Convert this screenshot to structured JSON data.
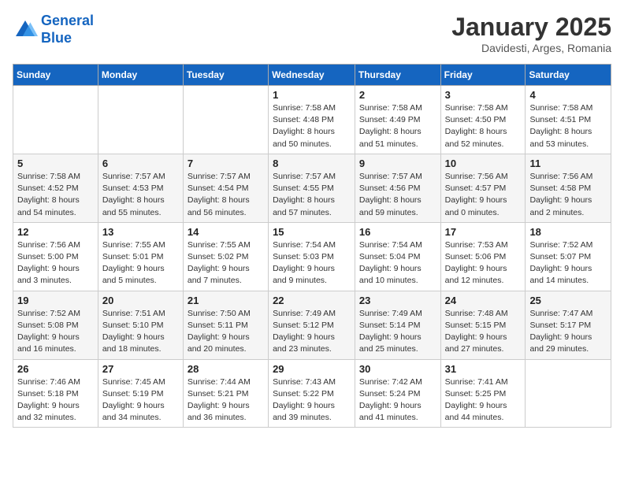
{
  "logo": {
    "line1": "General",
    "line2": "Blue"
  },
  "title": "January 2025",
  "subtitle": "Davidesti, Arges, Romania",
  "weekdays": [
    "Sunday",
    "Monday",
    "Tuesday",
    "Wednesday",
    "Thursday",
    "Friday",
    "Saturday"
  ],
  "weeks": [
    [
      {
        "day": "",
        "info": ""
      },
      {
        "day": "",
        "info": ""
      },
      {
        "day": "",
        "info": ""
      },
      {
        "day": "1",
        "info": "Sunrise: 7:58 AM\nSunset: 4:48 PM\nDaylight: 8 hours\nand 50 minutes."
      },
      {
        "day": "2",
        "info": "Sunrise: 7:58 AM\nSunset: 4:49 PM\nDaylight: 8 hours\nand 51 minutes."
      },
      {
        "day": "3",
        "info": "Sunrise: 7:58 AM\nSunset: 4:50 PM\nDaylight: 8 hours\nand 52 minutes."
      },
      {
        "day": "4",
        "info": "Sunrise: 7:58 AM\nSunset: 4:51 PM\nDaylight: 8 hours\nand 53 minutes."
      }
    ],
    [
      {
        "day": "5",
        "info": "Sunrise: 7:58 AM\nSunset: 4:52 PM\nDaylight: 8 hours\nand 54 minutes."
      },
      {
        "day": "6",
        "info": "Sunrise: 7:57 AM\nSunset: 4:53 PM\nDaylight: 8 hours\nand 55 minutes."
      },
      {
        "day": "7",
        "info": "Sunrise: 7:57 AM\nSunset: 4:54 PM\nDaylight: 8 hours\nand 56 minutes."
      },
      {
        "day": "8",
        "info": "Sunrise: 7:57 AM\nSunset: 4:55 PM\nDaylight: 8 hours\nand 57 minutes."
      },
      {
        "day": "9",
        "info": "Sunrise: 7:57 AM\nSunset: 4:56 PM\nDaylight: 8 hours\nand 59 minutes."
      },
      {
        "day": "10",
        "info": "Sunrise: 7:56 AM\nSunset: 4:57 PM\nDaylight: 9 hours\nand 0 minutes."
      },
      {
        "day": "11",
        "info": "Sunrise: 7:56 AM\nSunset: 4:58 PM\nDaylight: 9 hours\nand 2 minutes."
      }
    ],
    [
      {
        "day": "12",
        "info": "Sunrise: 7:56 AM\nSunset: 5:00 PM\nDaylight: 9 hours\nand 3 minutes."
      },
      {
        "day": "13",
        "info": "Sunrise: 7:55 AM\nSunset: 5:01 PM\nDaylight: 9 hours\nand 5 minutes."
      },
      {
        "day": "14",
        "info": "Sunrise: 7:55 AM\nSunset: 5:02 PM\nDaylight: 9 hours\nand 7 minutes."
      },
      {
        "day": "15",
        "info": "Sunrise: 7:54 AM\nSunset: 5:03 PM\nDaylight: 9 hours\nand 9 minutes."
      },
      {
        "day": "16",
        "info": "Sunrise: 7:54 AM\nSunset: 5:04 PM\nDaylight: 9 hours\nand 10 minutes."
      },
      {
        "day": "17",
        "info": "Sunrise: 7:53 AM\nSunset: 5:06 PM\nDaylight: 9 hours\nand 12 minutes."
      },
      {
        "day": "18",
        "info": "Sunrise: 7:52 AM\nSunset: 5:07 PM\nDaylight: 9 hours\nand 14 minutes."
      }
    ],
    [
      {
        "day": "19",
        "info": "Sunrise: 7:52 AM\nSunset: 5:08 PM\nDaylight: 9 hours\nand 16 minutes."
      },
      {
        "day": "20",
        "info": "Sunrise: 7:51 AM\nSunset: 5:10 PM\nDaylight: 9 hours\nand 18 minutes."
      },
      {
        "day": "21",
        "info": "Sunrise: 7:50 AM\nSunset: 5:11 PM\nDaylight: 9 hours\nand 20 minutes."
      },
      {
        "day": "22",
        "info": "Sunrise: 7:49 AM\nSunset: 5:12 PM\nDaylight: 9 hours\nand 23 minutes."
      },
      {
        "day": "23",
        "info": "Sunrise: 7:49 AM\nSunset: 5:14 PM\nDaylight: 9 hours\nand 25 minutes."
      },
      {
        "day": "24",
        "info": "Sunrise: 7:48 AM\nSunset: 5:15 PM\nDaylight: 9 hours\nand 27 minutes."
      },
      {
        "day": "25",
        "info": "Sunrise: 7:47 AM\nSunset: 5:17 PM\nDaylight: 9 hours\nand 29 minutes."
      }
    ],
    [
      {
        "day": "26",
        "info": "Sunrise: 7:46 AM\nSunset: 5:18 PM\nDaylight: 9 hours\nand 32 minutes."
      },
      {
        "day": "27",
        "info": "Sunrise: 7:45 AM\nSunset: 5:19 PM\nDaylight: 9 hours\nand 34 minutes."
      },
      {
        "day": "28",
        "info": "Sunrise: 7:44 AM\nSunset: 5:21 PM\nDaylight: 9 hours\nand 36 minutes."
      },
      {
        "day": "29",
        "info": "Sunrise: 7:43 AM\nSunset: 5:22 PM\nDaylight: 9 hours\nand 39 minutes."
      },
      {
        "day": "30",
        "info": "Sunrise: 7:42 AM\nSunset: 5:24 PM\nDaylight: 9 hours\nand 41 minutes."
      },
      {
        "day": "31",
        "info": "Sunrise: 7:41 AM\nSunset: 5:25 PM\nDaylight: 9 hours\nand 44 minutes."
      },
      {
        "day": "",
        "info": ""
      }
    ]
  ]
}
